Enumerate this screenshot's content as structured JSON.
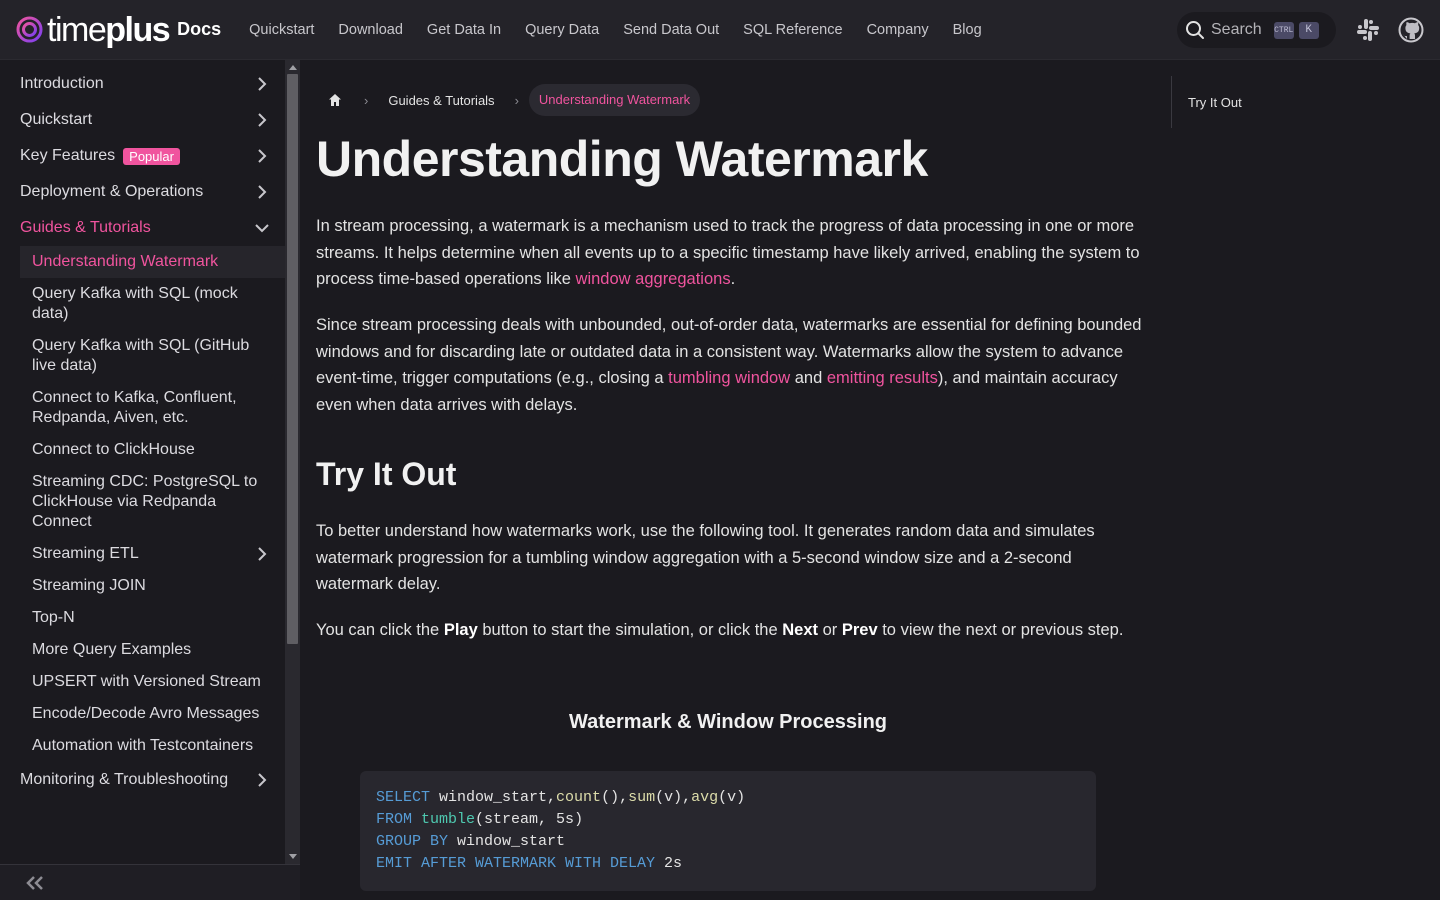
{
  "brand": {
    "name_bold": "time",
    "name_accent": "plus",
    "docs_label": "Docs"
  },
  "nav": {
    "links": [
      "Quickstart",
      "Download",
      "Get Data In",
      "Query Data",
      "Send Data Out",
      "SQL Reference",
      "Company",
      "Blog"
    ],
    "search": {
      "label": "Search",
      "key1": "CTRL",
      "key2": "K"
    }
  },
  "sidebar": {
    "items": [
      {
        "label": "Introduction"
      },
      {
        "label": "Quickstart"
      },
      {
        "label": "Key Features",
        "badge": "Popular"
      },
      {
        "label": "Deployment & Operations"
      },
      {
        "label": "Guides & Tutorials"
      }
    ],
    "sub_items": [
      "Understanding Watermark",
      "Query Kafka with SQL (mock data)",
      "Query Kafka with SQL (GitHub live data)",
      "Connect to Kafka, Confluent, Redpanda, Aiven, etc.",
      "Connect to ClickHouse",
      "Streaming CDC: PostgreSQL to ClickHouse via Redpanda Connect",
      "Streaming ETL",
      "Streaming JOIN",
      "Top-N",
      "More Query Examples",
      "UPSERT with Versioned Stream",
      "Encode/Decode Avro Messages",
      "Automation with Testcontainers"
    ],
    "bottom_item": "Monitoring & Troubleshooting"
  },
  "breadcrumb": {
    "parent": "Guides & Tutorials",
    "current": "Understanding Watermark"
  },
  "page": {
    "title": "Understanding Watermark",
    "p1_a": "In stream processing, a watermark is a mechanism used to track the progress of data processing in one or more streams. It helps determine when all events up to a specific timestamp have likely arrived, enabling the system to process time-based operations like ",
    "p1_link": "window aggregations",
    "p1_b": ".",
    "p2_a": "Since stream processing deals with unbounded, out-of-order data, watermarks are essential for defining bounded windows and for discarding late or outdated data in a consistent way. Watermarks allow the system to advance event-time, trigger computations (e.g., closing a ",
    "p2_link1": "tumbling window",
    "p2_b": " and ",
    "p2_link2": "emitting results",
    "p2_c": "), and maintain accuracy even when data arrives with delays.",
    "section_title": "Try It Out",
    "p3": "To better understand how watermarks work, use the following tool. It generates random data and simulates watermark progression for a tumbling window aggregation with a 5-second window size and a 2-second watermark delay.",
    "p4_a": "You can click the ",
    "p4_play": "Play",
    "p4_b": " button to start the simulation, or click the ",
    "p4_next": "Next",
    "p4_c": " or ",
    "p4_prev": "Prev",
    "p4_d": " to view the next or previous step.",
    "widget_title": "Watermark & Window Processing"
  },
  "code": {
    "l1_kw": "SELECT",
    "l1_a": " window_start,",
    "l1_f1": "count",
    "l1_b": "(),",
    "l1_f2": "sum",
    "l1_c": "(v),",
    "l1_f3": "avg",
    "l1_d": "(v)",
    "l2_kw": "FROM",
    "l2_fn": "tumble",
    "l2_a": "(stream, 5s)",
    "l3_kw": "GROUP BY",
    "l3_a": " window_start",
    "l4_kw": "EMIT AFTER WATERMARK WITH DELAY",
    "l4_a": " 2s"
  },
  "toc": {
    "items": [
      "Try It Out"
    ]
  }
}
